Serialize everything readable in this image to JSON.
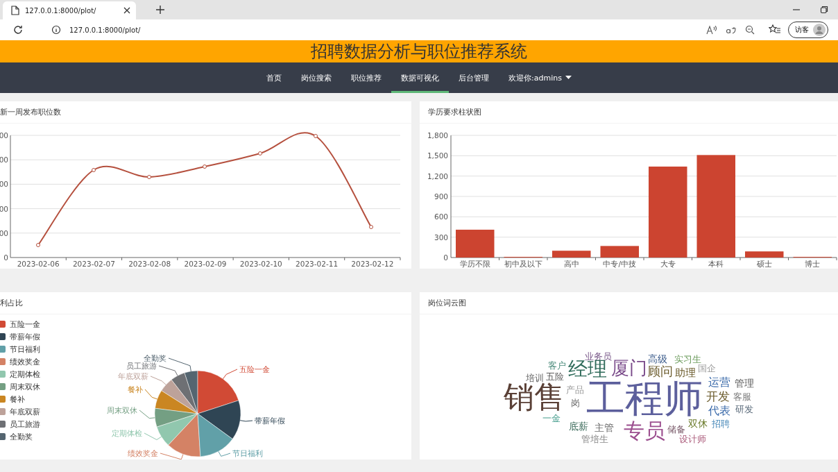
{
  "browser": {
    "tab_title": "127.0.0.1:8000/plot/",
    "url": "127.0.0.1:8000/plot/",
    "profile": "访客"
  },
  "header": {
    "title": "招聘数据分析与职位推荐系统"
  },
  "nav": [
    {
      "label": "首页",
      "selected": false
    },
    {
      "label": "岗位搜索",
      "selected": false
    },
    {
      "label": "职位推荐",
      "selected": false
    },
    {
      "label": "数据可视化",
      "selected": true
    },
    {
      "label": "后台管理",
      "selected": false
    },
    {
      "label": "欢迎你:admins",
      "selected": false,
      "kind": "dropdown"
    }
  ],
  "line_panel": {
    "title": "新一周发布职位数",
    "y_labels": [
      "00",
      "00",
      "00",
      "00",
      "00",
      "0"
    ],
    "x_labels": [
      "2023-02-06",
      "2023-02-07",
      "2023-02-08",
      "2023-02-09",
      "2023-02-10",
      "2023-02-11",
      "2023-02-12"
    ]
  },
  "bar_panel": {
    "title": "学历要求柱状图",
    "chart_data": {
      "type": "bar",
      "categories": [
        "学历不限",
        "初中及以下",
        "高中",
        "中专/中技",
        "大专",
        "本科",
        "硕士",
        "博士"
      ],
      "values": [
        410,
        10,
        100,
        170,
        1340,
        1510,
        90,
        10
      ],
      "ylim": [
        0,
        1800
      ],
      "yticks": [
        0,
        300,
        600,
        900,
        {
          "value": 1200,
          "label": "1,200"
        },
        {
          "value": 1500,
          "label": "1,500"
        },
        {
          "value": 1800,
          "label": "1,800"
        }
      ],
      "grid": true
    }
  },
  "pie_panel": {
    "title": "利占比",
    "legend": [
      {
        "name": "五险一金",
        "color": "#d14a35"
      },
      {
        "name": "带薪年假",
        "color": "#2f4554"
      },
      {
        "name": "节日福利",
        "color": "#61a0a8"
      },
      {
        "name": "绩效奖金",
        "color": "#d48265"
      },
      {
        "name": "定期体检",
        "color": "#91c7ae"
      },
      {
        "name": "周末双休",
        "color": "#749f83"
      },
      {
        "name": "餐补",
        "color": "#ca8622"
      },
      {
        "name": "年底双薪",
        "color": "#bda29a"
      },
      {
        "name": "员工旅游",
        "color": "#6e7074"
      },
      {
        "name": "全勤奖",
        "color": "#546570"
      }
    ],
    "slices": [
      {
        "label": "全勤奖",
        "color": "#546570"
      },
      {
        "label": "员工旅游",
        "color": "#6e7074"
      },
      {
        "label": "五险一金",
        "color": "#d14a35"
      },
      {
        "label": "年底双薪",
        "color": "#bda29a"
      },
      {
        "label": "餐补",
        "color": "#ca8622"
      },
      {
        "label": "周末双休",
        "color": "#749f83"
      },
      {
        "label": "带薪年假",
        "color": "#2f4554"
      },
      {
        "label": "定期体检",
        "color": "#91c7ae"
      },
      {
        "label": "绩效奖金",
        "color": "#d48265"
      },
      {
        "label": "节日福利",
        "color": "#61a0a8"
      }
    ]
  },
  "cloud_panel": {
    "title": "岗位词云图",
    "words": [
      {
        "text": "业务员",
        "color": "#7a5a8a"
      },
      {
        "text": "高级",
        "color": "#3a5a8a"
      },
      {
        "text": "实习生",
        "color": "#6a9a5a"
      },
      {
        "text": "客户",
        "color": "#4a8a7a"
      },
      {
        "text": "培训",
        "color": "#6a6a6a"
      },
      {
        "text": "五险",
        "color": "#5a5a5a"
      },
      {
        "text": "经理",
        "color": "#2f6b5a"
      },
      {
        "text": "厦门",
        "color": "#7a4b8a"
      },
      {
        "text": "顾问",
        "color": "#6a5a2a"
      },
      {
        "text": "助理",
        "color": "#6a5a2a"
      },
      {
        "text": "国企",
        "color": "#9a9a9a"
      },
      {
        "text": "销售",
        "color": "#5a4036"
      },
      {
        "text": "产品",
        "color": "#9a9a9a"
      },
      {
        "text": "岗",
        "color": "#6a6a6a"
      },
      {
        "text": "工程师",
        "color": "#5c5f9c"
      },
      {
        "text": "运营",
        "color": "#3a6aaa"
      },
      {
        "text": "管理",
        "color": "#5a5a5a"
      },
      {
        "text": "开发",
        "color": "#6a5a2a"
      },
      {
        "text": "客服",
        "color": "#7a7a7a"
      },
      {
        "text": "代表",
        "color": "#3a6aaa"
      },
      {
        "text": "研发",
        "color": "#5a6a7a"
      },
      {
        "text": "一金",
        "color": "#4aa090"
      },
      {
        "text": "底薪",
        "color": "#3a6a5a"
      },
      {
        "text": "主管",
        "color": "#6a6a6a"
      },
      {
        "text": "专员",
        "color": "#9c4f8f"
      },
      {
        "text": "储备",
        "color": "#7a5a6a"
      },
      {
        "text": "双休",
        "color": "#6a7a2a"
      },
      {
        "text": "招聘",
        "color": "#4a8aba"
      },
      {
        "text": "管培生",
        "color": "#8a8a8a"
      },
      {
        "text": "设计师",
        "color": "#aa5a7a"
      }
    ]
  }
}
